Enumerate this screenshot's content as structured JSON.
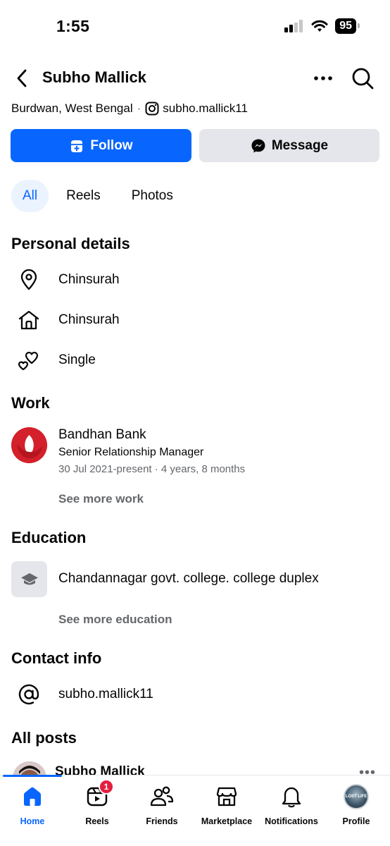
{
  "status_bar": {
    "time": "1:55",
    "battery": "95"
  },
  "header": {
    "title": "Subho Mallick"
  },
  "profile": {
    "location": "Burdwan, West Bengal",
    "separator": "·",
    "instagram": "subho.mallick11"
  },
  "actions": {
    "follow_label": "Follow",
    "message_label": "Message"
  },
  "tabs": [
    {
      "label": "All",
      "active": true
    },
    {
      "label": "Reels",
      "active": false
    },
    {
      "label": "Photos",
      "active": false
    }
  ],
  "personal_details": {
    "title": "Personal details",
    "items": [
      {
        "icon": "location-pin-icon",
        "text": "Chinsurah"
      },
      {
        "icon": "home-icon",
        "text": "Chinsurah"
      },
      {
        "icon": "hearts-icon",
        "text": "Single"
      }
    ]
  },
  "work": {
    "title": "Work",
    "company": "Bandhan Bank",
    "role": "Senior Relationship Manager",
    "dates": "30 Jul 2021-present · 4 years, 8 months",
    "see_more": "See more work"
  },
  "education": {
    "title": "Education",
    "school": "Chandannagar govt. college. college duplex",
    "see_more": "See more education"
  },
  "contact": {
    "title": "Contact info",
    "handle": "subho.mallick11"
  },
  "posts": {
    "title": "All posts",
    "author": "Subho Mallick",
    "more": "•••"
  },
  "bottom_nav": {
    "items": [
      {
        "label": "Home",
        "icon": "home-icon",
        "active": true
      },
      {
        "label": "Reels",
        "icon": "reels-icon",
        "badge": "1"
      },
      {
        "label": "Friends",
        "icon": "friends-icon"
      },
      {
        "label": "Marketplace",
        "icon": "marketplace-icon"
      },
      {
        "label": "Notifications",
        "icon": "bell-icon"
      },
      {
        "label": "Profile",
        "icon": "profile-avatar",
        "avatar_text": "LOST LIFE"
      }
    ]
  },
  "colors": {
    "accent": "#0866ff",
    "secondary_button": "#e4e6eb",
    "muted_text": "#65676b",
    "badge": "#e41e3f",
    "bank_red": "#d4202b"
  }
}
